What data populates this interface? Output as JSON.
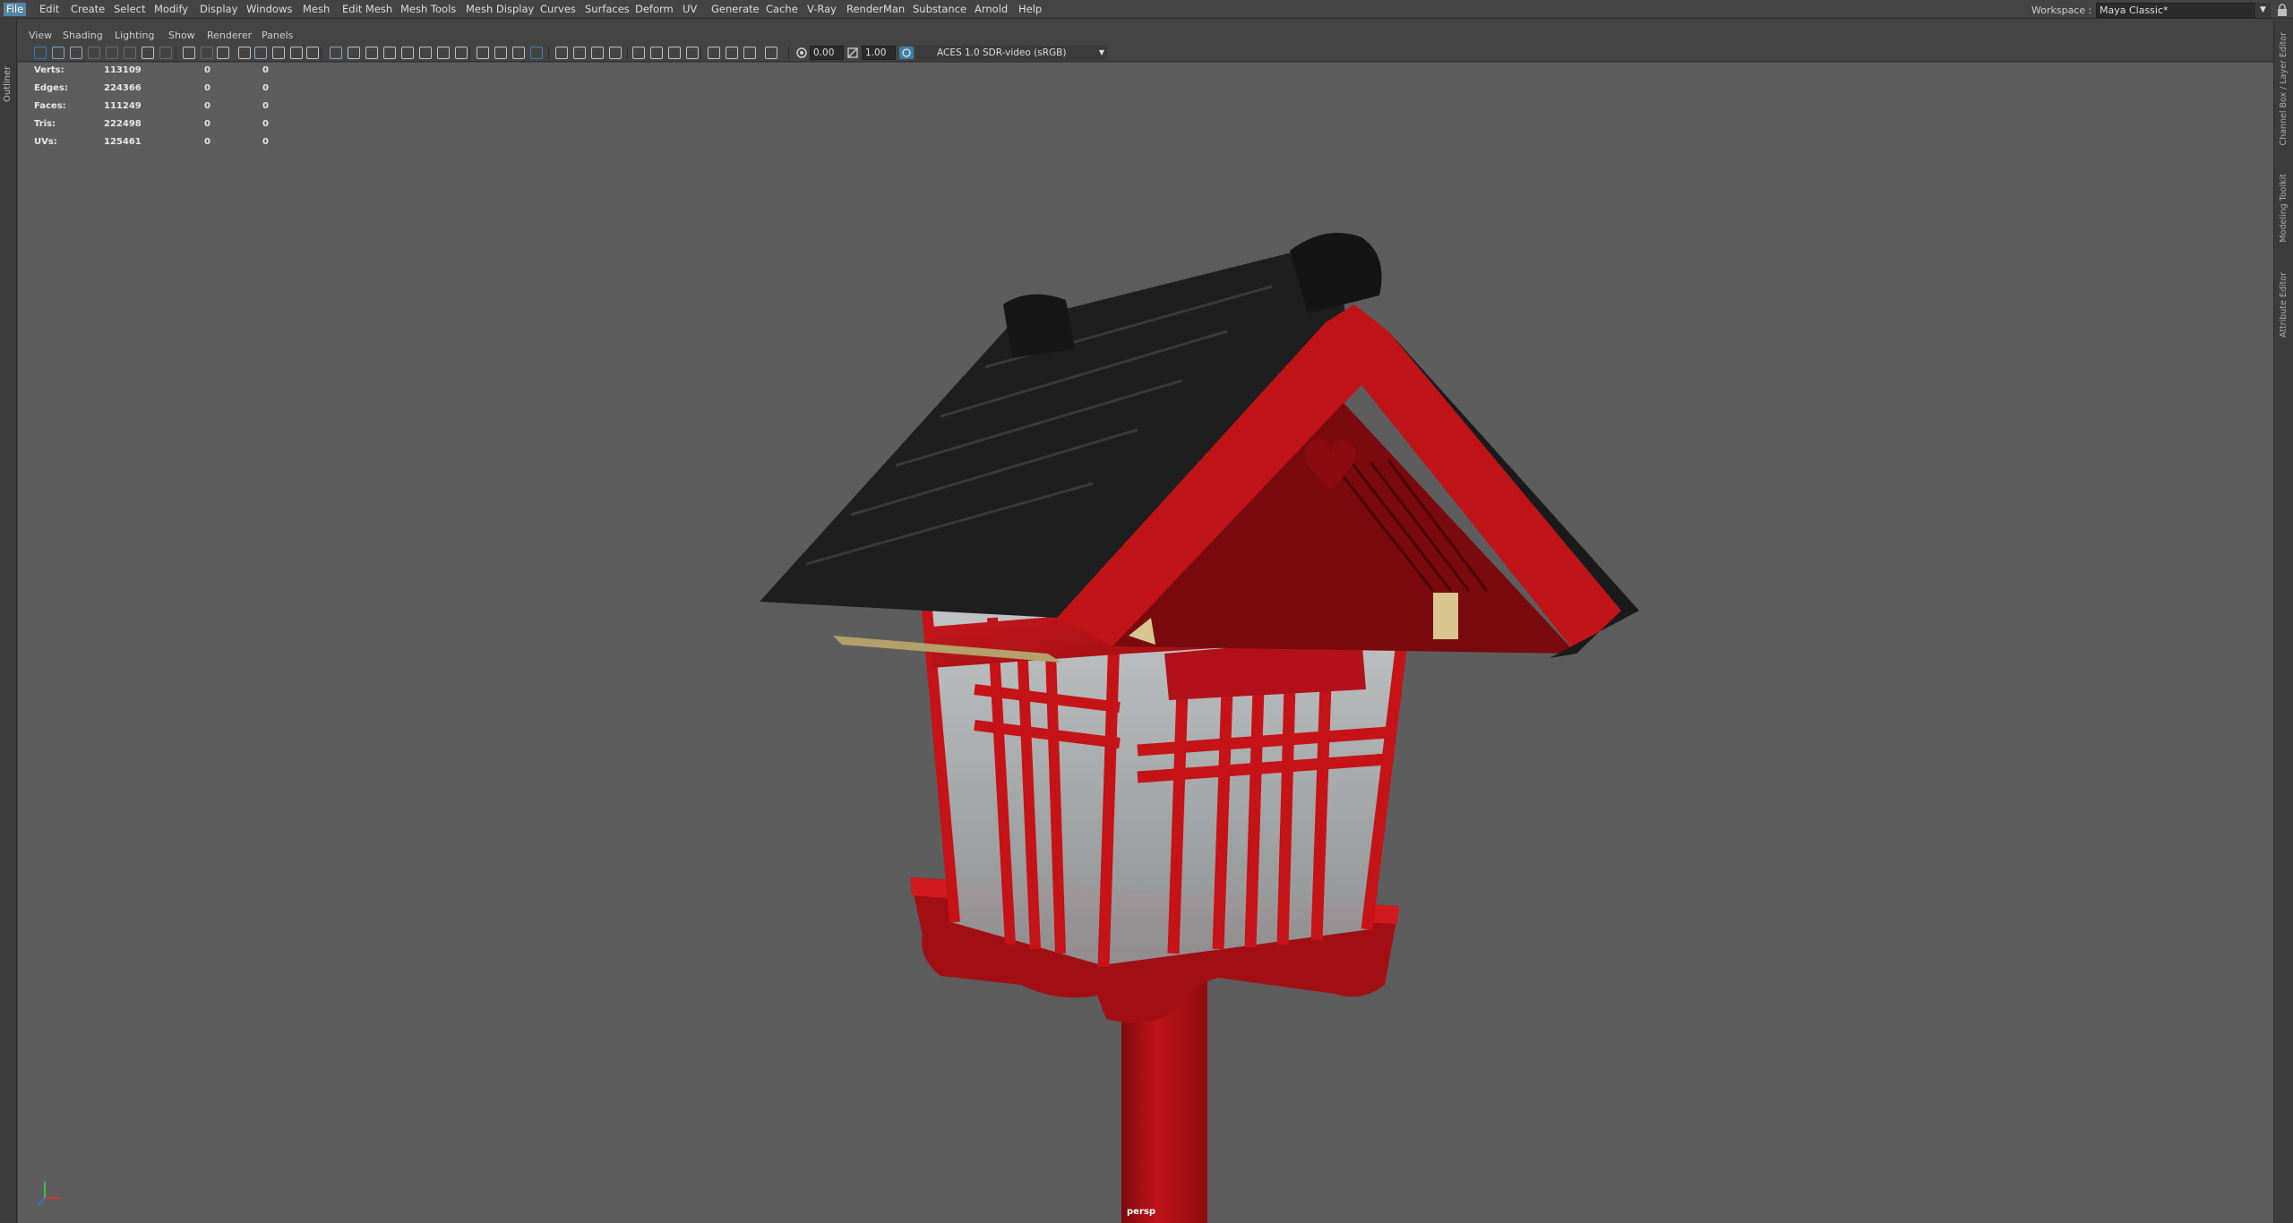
{
  "menubar": {
    "items": [
      "File",
      "Edit",
      "Create",
      "Select",
      "Modify",
      "Display",
      "Windows",
      "Mesh",
      "Edit Mesh",
      "Mesh Tools",
      "Mesh Display",
      "Curves",
      "Surfaces",
      "Deform",
      "UV",
      "Generate",
      "Cache",
      "V-Ray",
      "RenderMan",
      "Substance",
      "Arnold",
      "Help"
    ],
    "active": "File"
  },
  "workspace": {
    "label": "Workspace :",
    "value": "Maya Classic*"
  },
  "left_tabs": {
    "outliner": "Outliner"
  },
  "right_tabs": {
    "channel_box": "Channel Box / Layer Editor",
    "modeling_toolkit": "Modeling Toolkit",
    "attribute_editor": "Attribute Editor"
  },
  "panel_menu": [
    "View",
    "Shading",
    "Lighting",
    "Show",
    "Renderer",
    "Panels"
  ],
  "toolbar": {
    "exposure": "0.00",
    "gamma": "1.00",
    "color_space": "ACES 1.0 SDR-video (sRGB)"
  },
  "hud": {
    "rows": [
      {
        "label": "Verts:",
        "v1": "113109",
        "v2": "0",
        "v3": "0"
      },
      {
        "label": "Edges:",
        "v1": "224366",
        "v2": "0",
        "v3": "0"
      },
      {
        "label": "Faces:",
        "v1": "111249",
        "v2": "0",
        "v3": "0"
      },
      {
        "label": "Tris:",
        "v1": "222498",
        "v2": "0",
        "v3": "0"
      },
      {
        "label": "UVs:",
        "v1": "125461",
        "v2": "0",
        "v3": "0"
      }
    ]
  },
  "viewport": {
    "camera": "persp",
    "background": "#5d5d5d",
    "model_colors": {
      "lacquer_red": "#c0141a",
      "roof_black": "#1c1c1c",
      "glass": "#b9bcbd",
      "accent_gold": "#d8c590"
    }
  }
}
